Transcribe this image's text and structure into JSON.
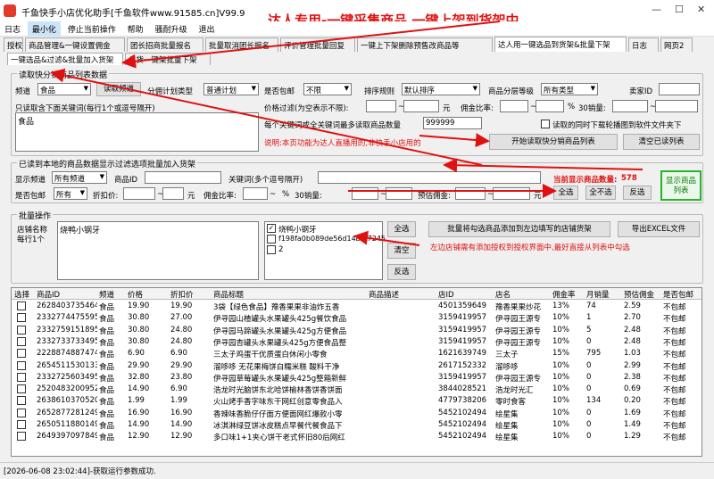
{
  "window": {
    "title": "千鱼快手小店优化助手[千鱼软件www.91585.cn]V99.9",
    "min": "—",
    "max": "☐",
    "close": "✕"
  },
  "overlay": {
    "title": "达人专用-一键采集商品 一键上架到货架中"
  },
  "menu": [
    "日志",
    "最小化",
    "停止当前操作",
    "帮助",
    "骚耐升级",
    "退出"
  ],
  "tabs": [
    "授权",
    "商品管理&一键设置佣金",
    "团长招商批量报名",
    "批量取消团长报名",
    "评价管理批量回复",
    "一键上下架删除预售改商品等",
    "达人用一键选品到货架&批量下架",
    "日志",
    "网页2"
  ],
  "subtabs": [
    "一键选品&过滤&批量加入货架",
    "从货一键架批量下架"
  ],
  "read_group": {
    "title": "读取快分销商品列表数据",
    "channel_label": "频道",
    "channel_value": "食品",
    "read_channel_btn": "读取频道",
    "plan_label": "分佣计划类型",
    "plan_value": "普通计划",
    "shipping_label": "是否包邮",
    "shipping_value": "不限",
    "sort_label": "排序规则",
    "sort_value": "默认排序",
    "level_label": "商品分层等级",
    "level_value": "所有类型",
    "seller_label": "卖家ID",
    "keyword_label": "只读取含下面关键词(每行1个或逗号隔开)",
    "keyword_value": "食品",
    "price_label": "价格过滤(为空表示不限):",
    "yuan": "元",
    "commission_label": "佣金比率:",
    "percent": "%",
    "sales_label": "30销量:",
    "max_label": "每个关键词或全关键词最多读取商品数量",
    "max_value": "999999",
    "chk_download_label": "读取的同时下载轮播图到软件文件夹下",
    "note": "说明:本页功能为达人直播用的,非快手小店用的",
    "start_btn": "开始读取快分销商品列表",
    "clear_btn": "清空已读列表"
  },
  "filter_group": {
    "title": "已读到本地的商品数据显示过滤选项批量加入货架",
    "channel_label": "显示频道",
    "channel_value": "所有频道",
    "product_id_label": "商品ID",
    "keyword_label": "关键词(多个逗号隔开)",
    "count_label": "当前显示商品数量:",
    "count_value": "578",
    "shipping_label": "是否包邮",
    "shipping_value": "所有",
    "discount_label": "折扣价:",
    "yuan": "元",
    "commission_label": "佣金比率:",
    "percent": "%",
    "sales_label": "30销量:",
    "est_label": "预估佣金:",
    "select_all_btn": "全选",
    "unselect_btn": "全不选",
    "invert_btn": "反选",
    "show_btn": "显示商品列表"
  },
  "batch_group": {
    "title": "批量操作",
    "store_label": "店铺名称",
    "per_row_label": "每行1个",
    "store_value": "烧鸭小钢牙",
    "list_items": [
      {
        "text": "烧鸭小钢牙",
        "checked": true
      },
      {
        "text": "f198fa0b089de56d14bf57245",
        "checked": false
      },
      {
        "text": "2",
        "checked": false
      }
    ],
    "select_all_btn": "全选",
    "clear_btn": "清空",
    "invert_btn": "反选",
    "add_btn": "批量将勾选商品添加到左边填写的店铺货架",
    "export_btn": "导出EXCEL文件",
    "note": "左边店铺需有添加授权到授权界面中,最好直接从列表中勾选"
  },
  "table": {
    "headers": [
      "选择",
      "商品ID",
      "频道",
      "价格",
      "折扣价",
      "商品标题",
      "商品描述",
      "店ID",
      "店名",
      "佣金率",
      "月销量",
      "预估佣金",
      "是否包邮"
    ],
    "rows": [
      [
        "2628403735464",
        "食品",
        "19.90",
        "19.90",
        "3袋【绿色食品】豫香果果非油炸五香",
        "",
        "4501359649",
        "豫香果果炒花",
        "13%",
        "74",
        "2.59",
        "不包邮"
      ],
      [
        "2332774475595",
        "食品",
        "30.80",
        "27.00",
        "伊寻园山楂罐头水果罐头425g餐饮食品",
        "",
        "3159419957",
        "伊寻园王源专",
        "10%",
        "1",
        "2.70",
        "不包邮"
      ],
      [
        "2332759151895",
        "食品",
        "30.80",
        "24.80",
        "伊寻园马蹄罐头水果罐头425g方便食品",
        "",
        "3159419957",
        "伊寻园王源专",
        "10%",
        "5",
        "2.48",
        "不包邮"
      ],
      [
        "2332733733495",
        "食品",
        "30.80",
        "24.80",
        "伊寻园杏罐头水果罐头425g方便食品整",
        "",
        "3159419957",
        "伊寻园王源专",
        "10%",
        "0",
        "2.48",
        "不包邮"
      ],
      [
        "2228874887474",
        "食品",
        "6.90",
        "6.90",
        "三太子鸡蛋干优质蛋白休闲小零食",
        "",
        "1621639749",
        "三太子",
        "15%",
        "795",
        "1.03",
        "不包邮"
      ],
      [
        "2654511530133",
        "食品",
        "29.90",
        "29.90",
        "溜哆哆 无花果梅饼白糯米糕 酸料干净",
        "",
        "2617152332",
        "溜哆哆",
        "10%",
        "0",
        "2.99",
        "不包邮"
      ],
      [
        "2332725603495",
        "食品",
        "32.80",
        "23.80",
        "伊寻园草莓罐头水果罐头425g整箱新鲜",
        "",
        "3159419957",
        "伊寻园王源专",
        "10%",
        "0",
        "2.38",
        "不包邮"
      ],
      [
        "2520483200952",
        "食品",
        "14.90",
        "6.90",
        "浩龙时光脑饼东北哈饼榆林香饼香饼面",
        "",
        "3844028521",
        "浩龙时光汇",
        "10%",
        "0",
        "0.69",
        "不包邮"
      ],
      [
        "2638610370520",
        "食品",
        "1.99",
        "1.99",
        "火山烤手香字味东干网红创意零食品入",
        "",
        "4779738206",
        "零时食客",
        "10%",
        "134",
        "0.20",
        "不包邮"
      ],
      [
        "2652877281249",
        "食品",
        "16.90",
        "16.90",
        "香辣味香脆仔仔面方便面网红爆款小零",
        "",
        "5452102494",
        "绘星集",
        "10%",
        "0",
        "1.69",
        "不包邮"
      ],
      [
        "2650511880149",
        "食品",
        "14.90",
        "14.90",
        "冰淇淋绿豆饼冰皮糕点早餐代餐食品下",
        "",
        "5452102494",
        "绘星集",
        "10%",
        "0",
        "1.49",
        "不包邮"
      ],
      [
        "2649397097849",
        "食品",
        "12.90",
        "12.90",
        "多口味1+1夹心饼干老式怀旧80后网红",
        "",
        "5452102494",
        "绘星集",
        "10%",
        "0",
        "1.29",
        "不包邮"
      ]
    ]
  },
  "status": {
    "text": "[2026-06-08 23:02:44]-获取运行参数成功."
  }
}
